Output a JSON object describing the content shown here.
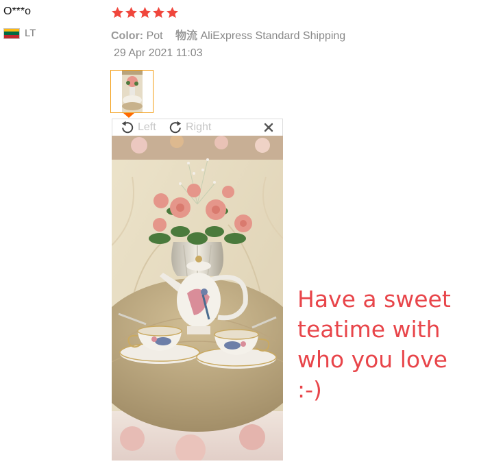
{
  "reviewer": {
    "name": "O***o",
    "country_code": "LT",
    "flag_colors": [
      "#fdb913",
      "#006a44",
      "#c1272d"
    ]
  },
  "rating": {
    "stars": 5,
    "max": 5,
    "color": "#f0463c"
  },
  "order": {
    "color_label": "Color:",
    "color_value": "Pot",
    "shipping_label": "物流",
    "shipping_value": "AliExpress Standard Shipping"
  },
  "date": "29 Apr 2021 11:03",
  "viewer": {
    "rotate_left_label": "Left",
    "rotate_right_label": "Right",
    "rotate_left_icon": "rotate-left-icon",
    "rotate_right_icon": "rotate-right-icon",
    "close_icon": "close-icon",
    "accent_color": "#ff6a00"
  },
  "review_text": "Have a sweet teatime with who you love :-)",
  "review_text_color": "#e8454a"
}
